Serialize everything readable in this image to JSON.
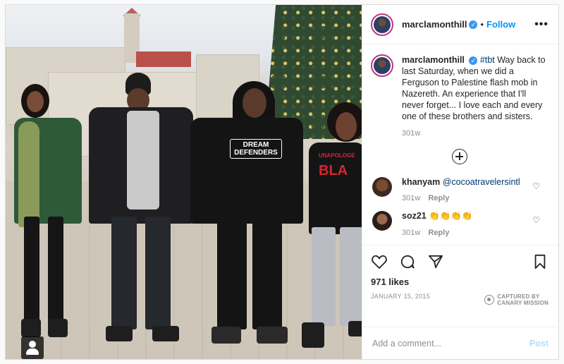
{
  "post": {
    "username": "marclamonthill",
    "follow_label": "Follow",
    "separator": "•",
    "more_label": "•••"
  },
  "photo": {
    "hoodie_line1": "DREAM",
    "hoodie_line2": "DEFENDERS",
    "shirt_small": "UNAPOLOGE",
    "shirt_big": "BLA"
  },
  "caption": {
    "username": "marclamonthill",
    "hashtag": "#tbt",
    "text": " Way back to last Saturday, when we did a Ferguson to Palestine flash mob in Nazereth. An experience that I'll never forget... I love each and every one of these brothers and sisters.",
    "age": "301w"
  },
  "comments": [
    {
      "username": "khanyam",
      "text": "@cocoatravelersintl",
      "age": "301w",
      "reply_label": "Reply"
    },
    {
      "username": "soz21",
      "text": "👏👏👏👏",
      "age": "301w",
      "reply_label": "Reply"
    }
  ],
  "engagement": {
    "likes": "971 likes",
    "date": "JANUARY 15, 2015"
  },
  "watermark": {
    "line1": "CAPTURED BY",
    "line2": "CANARY MISSION"
  },
  "compose": {
    "placeholder": "Add a comment...",
    "post_label": "Post"
  },
  "colors": {
    "accent": "#0095f6",
    "verified": "#3897f0",
    "avatar_ring": "#c13584"
  }
}
